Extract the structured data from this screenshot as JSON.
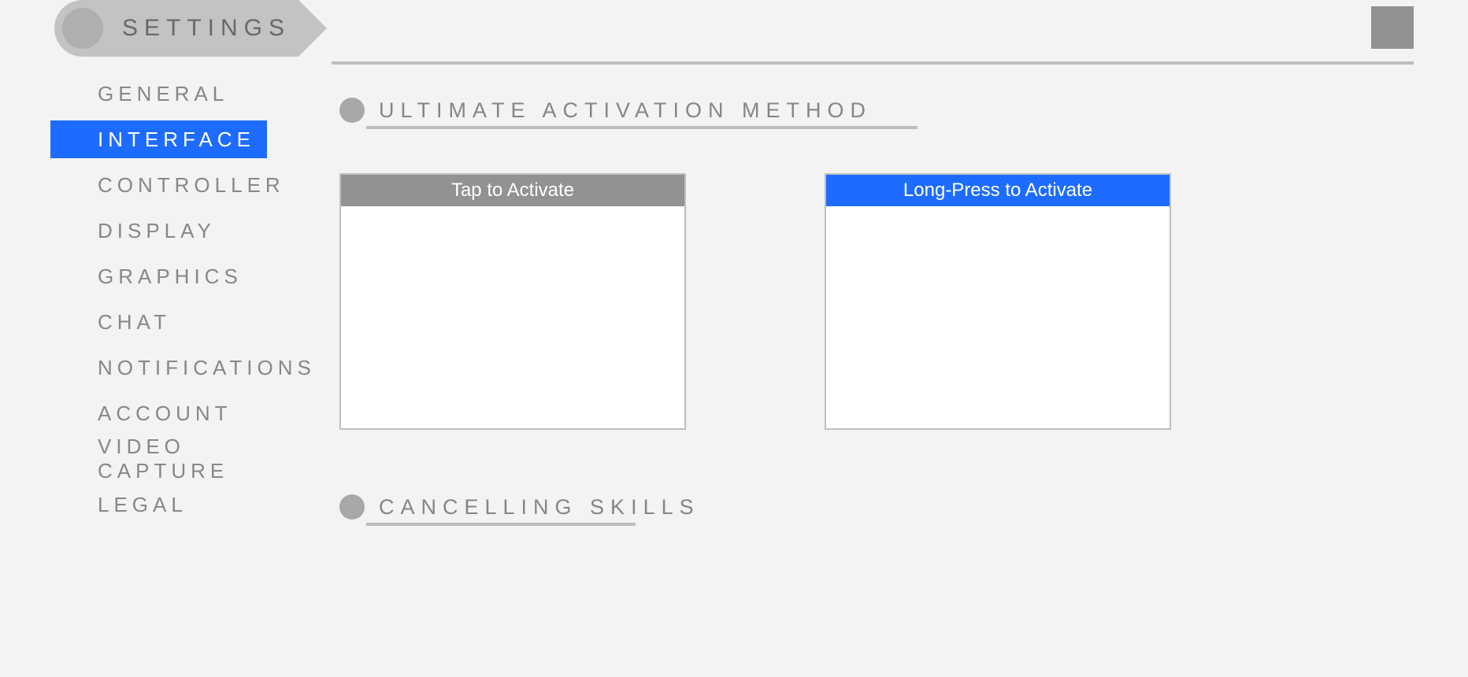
{
  "header": {
    "title": "SETTINGS"
  },
  "sidebar": {
    "items": [
      {
        "label": "GENERAL"
      },
      {
        "label": "INTERFACE"
      },
      {
        "label": "CONTROLLER"
      },
      {
        "label": "DISPLAY"
      },
      {
        "label": "GRAPHICS"
      },
      {
        "label": "CHAT"
      },
      {
        "label": "NOTIFICATIONS"
      },
      {
        "label": "ACCOUNT"
      },
      {
        "label": "VIDEO CAPTURE"
      },
      {
        "label": "LEGAL"
      }
    ],
    "selected_index": 1
  },
  "sections": {
    "ultimate": {
      "title": "ULTIMATE ACTIVATION METHOD",
      "options": [
        {
          "label": "Tap to Activate",
          "selected": false
        },
        {
          "label": "Long-Press to Activate",
          "selected": true
        }
      ]
    },
    "cancelling": {
      "title": "CANCELLING SKILLS"
    }
  }
}
